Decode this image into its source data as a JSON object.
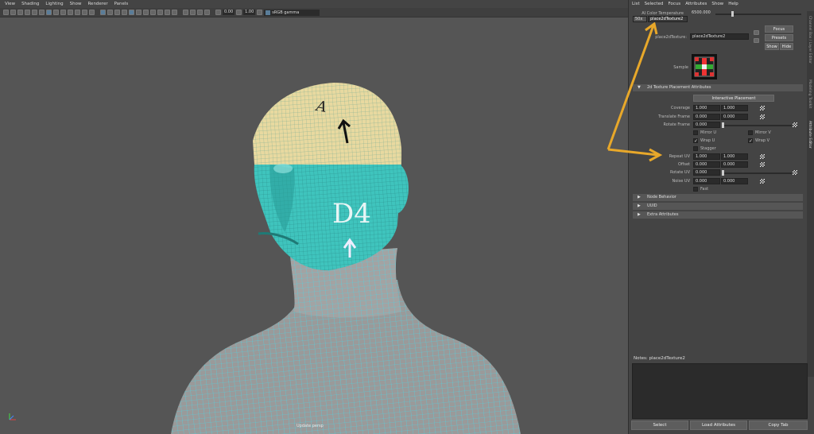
{
  "viewport": {
    "menu": [
      "View",
      "Shading",
      "Lighting",
      "Show",
      "Renderer",
      "Panels"
    ],
    "toolbar": {
      "exposure_value": "0.00",
      "gamma_value": "1.00",
      "colorspace": "sRGB gamma"
    },
    "camera_label": "Update persp",
    "annotations": {
      "top_letter": "A",
      "face_label": "D4"
    }
  },
  "attribute_editor": {
    "menu": [
      "List",
      "Selected",
      "Focus",
      "Attributes",
      "Show",
      "Help"
    ],
    "color_temp_label": "AI Color Temperature",
    "color_temp_value": "6500.000",
    "tab": "place2dTexture2",
    "tab_prefix": "50x",
    "node_label": "place2dTexture:",
    "node_value": "place2dTexture2",
    "buttons": {
      "focus": "Focus",
      "presets": "Presets",
      "show": "Show",
      "hide": "Hide"
    },
    "sample_label": "Sample",
    "section_open": "2d Texture Placement Attributes",
    "interactive_button": "Interactive Placement",
    "coverage": {
      "label": "Coverage",
      "u": "1.000",
      "v": "1.000"
    },
    "translate_frame": {
      "label": "Translate Frame",
      "u": "0.000",
      "v": "0.000"
    },
    "rotate_frame": {
      "label": "Rotate Frame",
      "value": "0.000"
    },
    "checks": {
      "mirror_u": "Mirror U",
      "mirror_v": "Mirror V",
      "wrap_u": "Wrap U",
      "wrap_v": "Wrap V",
      "stagger": "Stagger",
      "fast": "Fast"
    },
    "repeat_uv": {
      "label": "Repeat UV",
      "u": "1.000",
      "v": "1.000"
    },
    "offset": {
      "label": "Offset",
      "u": "0.000",
      "v": "0.000"
    },
    "rotate_uv": {
      "label": "Rotate UV",
      "value": "0.000"
    },
    "noise_uv": {
      "label": "Noise UV",
      "u": "0.000",
      "v": "0.000"
    },
    "collapsed_sections": [
      "Node Behavior",
      "UUID",
      "Extra Attributes"
    ],
    "notes_label": "Notes:  place2dTexture2",
    "bottom_buttons": [
      "Select",
      "Load Attributes",
      "Copy Tab"
    ],
    "side_tabs": [
      "Channel Box / Layer Editor",
      "Modeling Toolkit",
      "Attribute Editor"
    ]
  },
  "colors": {
    "arrow": "#e8a82a",
    "mesh_cyan": "#3fc4bd",
    "mesh_yellow": "#e8d9a0",
    "wire": "#48d8e8"
  }
}
